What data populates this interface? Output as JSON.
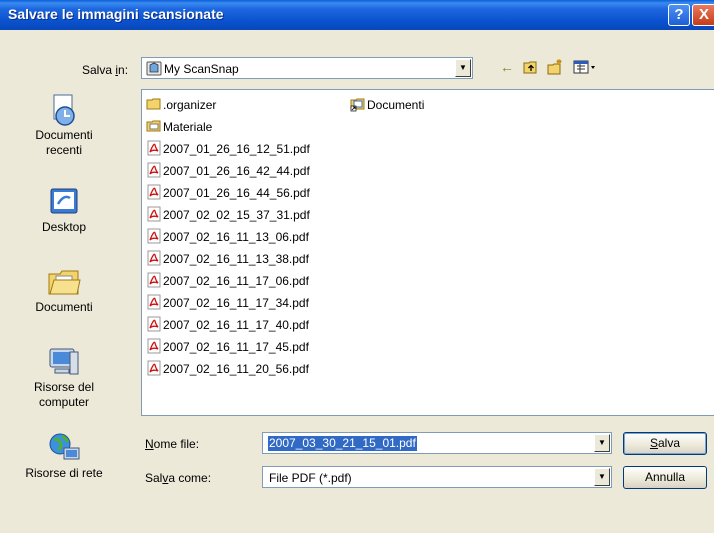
{
  "window": {
    "title": "Salvare le immagini scansionate"
  },
  "titlebar": {
    "help_label": "?",
    "close_label": "X"
  },
  "save_in": {
    "label_pre": "Salva ",
    "label_u": "i",
    "label_post": "n:",
    "value": "My ScanSnap"
  },
  "places": [
    {
      "label": "Documenti\nrecenti",
      "icon": "recent-documents-icon"
    },
    {
      "label": "Desktop",
      "icon": "desktop-icon"
    },
    {
      "label": "Documenti",
      "icon": "my-documents-icon"
    },
    {
      "label": "Risorse del\ncomputer",
      "icon": "my-computer-icon"
    },
    {
      "label": "Risorse di rete",
      "icon": "network-icon"
    }
  ],
  "files": [
    {
      "name": ".organizer",
      "type": "folder"
    },
    {
      "name": "Materiale",
      "type": "folder-special"
    },
    {
      "name": "2007_01_26_16_12_51.pdf",
      "type": "pdf"
    },
    {
      "name": "2007_01_26_16_42_44.pdf",
      "type": "pdf"
    },
    {
      "name": "2007_01_26_16_44_56.pdf",
      "type": "pdf"
    },
    {
      "name": "2007_02_02_15_37_31.pdf",
      "type": "pdf"
    },
    {
      "name": "2007_02_16_11_13_06.pdf",
      "type": "pdf"
    },
    {
      "name": "2007_02_16_11_13_38.pdf",
      "type": "pdf"
    },
    {
      "name": "2007_02_16_11_17_06.pdf",
      "type": "pdf"
    },
    {
      "name": "2007_02_16_11_17_34.pdf",
      "type": "pdf"
    },
    {
      "name": "2007_02_16_11_17_40.pdf",
      "type": "pdf"
    },
    {
      "name": "2007_02_16_11_17_45.pdf",
      "type": "pdf"
    },
    {
      "name": "2007_02_16_11_20_56.pdf",
      "type": "pdf"
    },
    {
      "name": "Documenti",
      "type": "shortcut"
    }
  ],
  "filename": {
    "label_u": "N",
    "label_post": "ome file:",
    "value": "2007_03_30_21_15_01.pdf"
  },
  "save_as": {
    "label_pre": "Sal",
    "label_u": "v",
    "label_post": "a come:",
    "value": "File PDF (*.pdf)"
  },
  "buttons": {
    "save_u": "S",
    "save_post": "alva",
    "cancel": "Annulla"
  },
  "colors": {
    "titlebar": "#0a52cf",
    "selection": "#316ac5",
    "pdf_red": "#d01010"
  }
}
